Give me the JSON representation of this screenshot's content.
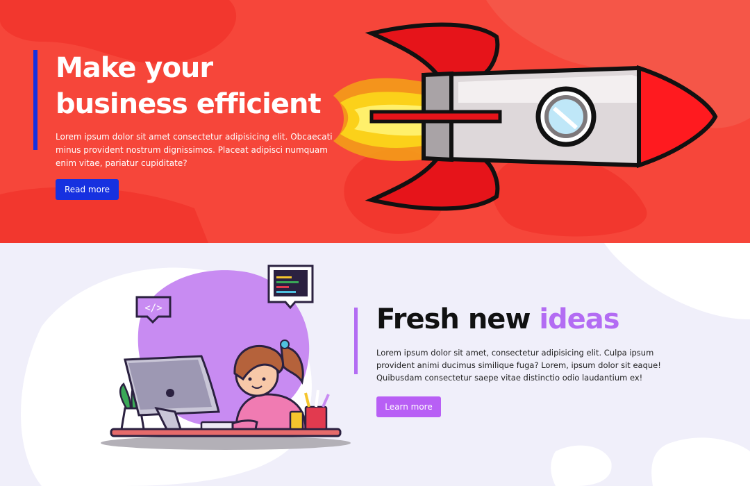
{
  "hero": {
    "title_line1": "Make your",
    "title_line2": "business efficient",
    "description": "Lorem ipsum dolor sit amet consectetur adipisicing elit. Obcaecati minus provident nostrum dignissimos. Placeat adipisci numquam enim vitae, pariatur cupiditate?",
    "button_label": "Read more",
    "illustration": "rocket-illustration"
  },
  "ideas": {
    "title_part1": "Fresh new ",
    "title_accent": "ideas",
    "description": "Lorem ipsum dolor sit amet, consectetur adipisicing elit. Culpa ipsum provident animi ducimus similique fuga? Lorem, ipsum dolor sit eaque! Quibusdam consectetur saepe vitae distinctio odio laudantium ex!",
    "button_label": "Learn more",
    "illustration": "developer-at-computer-illustration",
    "code_badge": "</>"
  },
  "colors": {
    "hero_bg": "#f6463a",
    "hero_accent": "#1631e0",
    "ideas_bg": "#f0effa",
    "ideas_accent": "#b36cf3"
  }
}
